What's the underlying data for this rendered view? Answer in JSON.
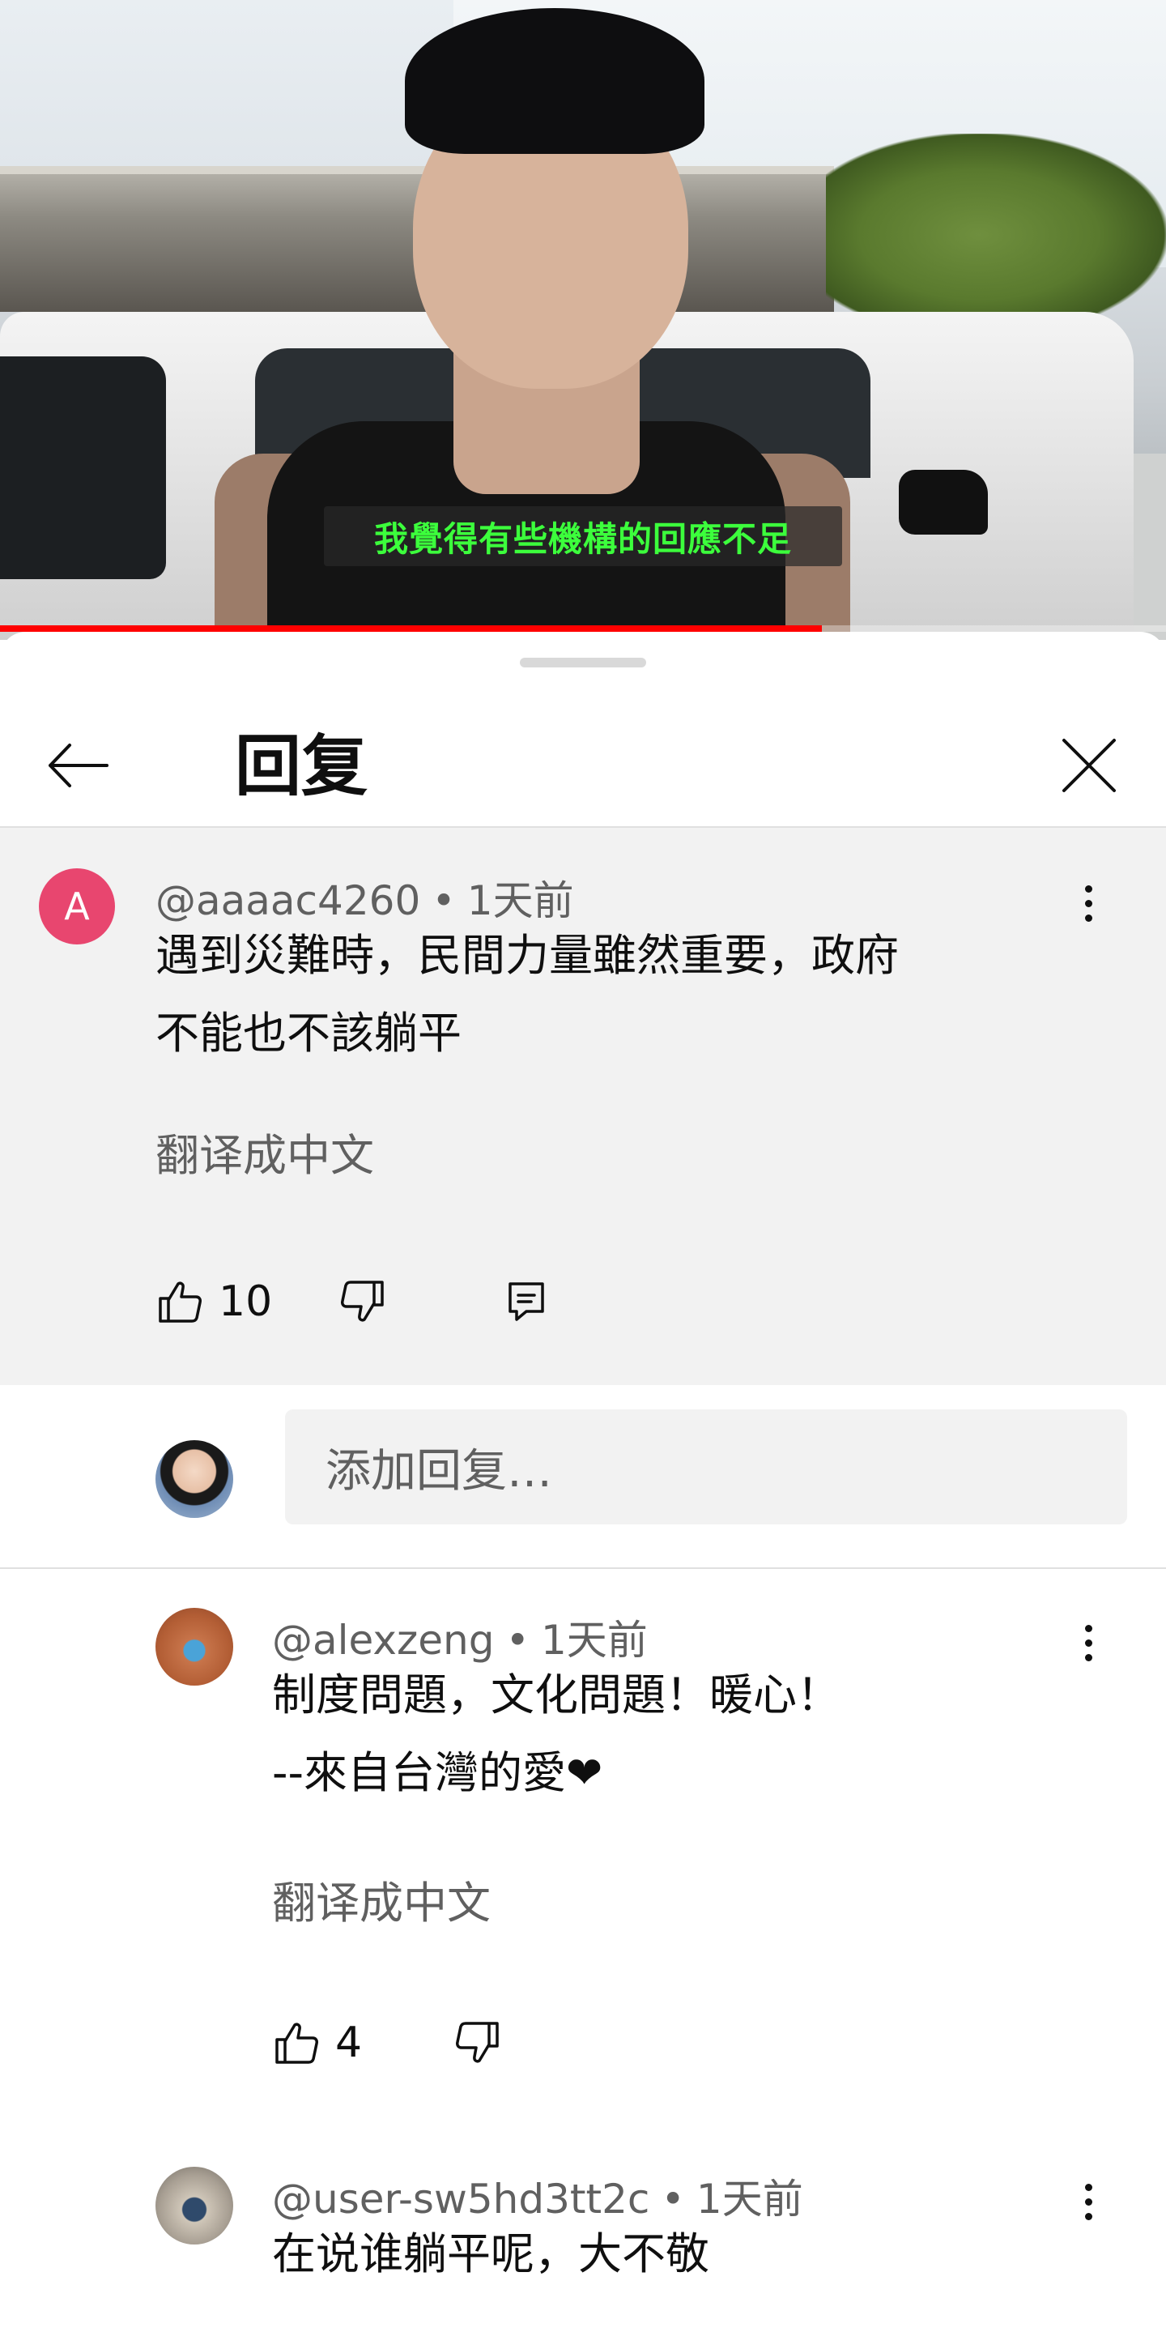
{
  "video": {
    "subtitle": "我覺得有些機構的回應不足",
    "progress_fraction": 0.705
  },
  "panel": {
    "title": "回复"
  },
  "parent_comment": {
    "author": "@aaaac4260",
    "time": "1天前",
    "text_line1": "遇到災難時，民間力量雖然重要，政府",
    "text_line2": "不能也不該躺平",
    "translate_label": "翻译成中文",
    "likes": "10",
    "avatar_letter": "A",
    "avatar_color": "#e8466f"
  },
  "reply_input": {
    "placeholder": "添加回复…"
  },
  "replies": [
    {
      "author": "@alexzeng",
      "time": "1天前",
      "text_line1": "制度問題，文化問題！暖心！",
      "text_line2": "--來自台灣的愛❤",
      "translate_label": "翻译成中文",
      "likes": "4"
    },
    {
      "author": "@user-sw5hd3tt2c",
      "time": "1天前",
      "text_line1": "在说谁躺平呢，大不敬"
    }
  ],
  "icons": {
    "back": "arrow-left-icon",
    "close": "close-icon",
    "like": "thumbs-up-icon",
    "dislike": "thumbs-down-icon",
    "reply": "comment-icon",
    "more": "more-vertical-icon"
  },
  "colors": {
    "progress": "#ff0000",
    "subtitle_text": "#3cff3c",
    "secondary_text": "#606060"
  }
}
